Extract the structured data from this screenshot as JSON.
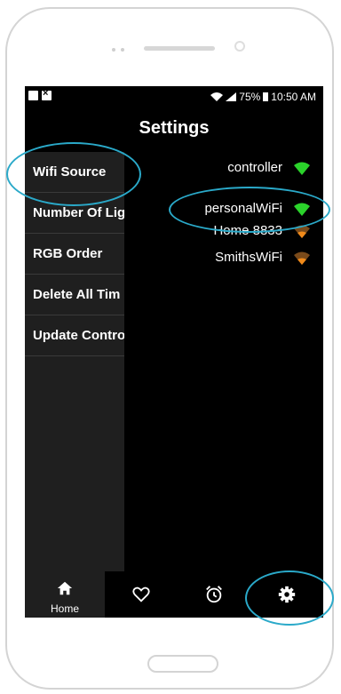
{
  "status_bar": {
    "battery_percent": "75%",
    "time": "10:50 AM"
  },
  "header": {
    "title": "Settings"
  },
  "sidebar": {
    "items": [
      {
        "label": "Wifi Source"
      },
      {
        "label": "Number Of Lig"
      },
      {
        "label": "RGB Order"
      },
      {
        "label": "Delete All Tim"
      },
      {
        "label": "Update Contro"
      }
    ]
  },
  "wifi_networks": [
    {
      "name": "controller",
      "signal_color": "#2bd32b"
    },
    {
      "name": "personalWiFi",
      "signal_color": "#2bd32b"
    },
    {
      "name": "Home 8833",
      "signal_color": "#f08a1a"
    },
    {
      "name": "SmithsWiFi",
      "signal_color": "#f08a1a"
    }
  ],
  "bottom_nav": {
    "home_label": "Home",
    "icons": [
      "home-icon",
      "heart-icon",
      "alarm-clock-icon",
      "gear-icon"
    ]
  },
  "colors": {
    "highlight": "#2aa9c9",
    "sidebar_bg": "#1f1f1f",
    "screen_bg": "#000000"
  }
}
